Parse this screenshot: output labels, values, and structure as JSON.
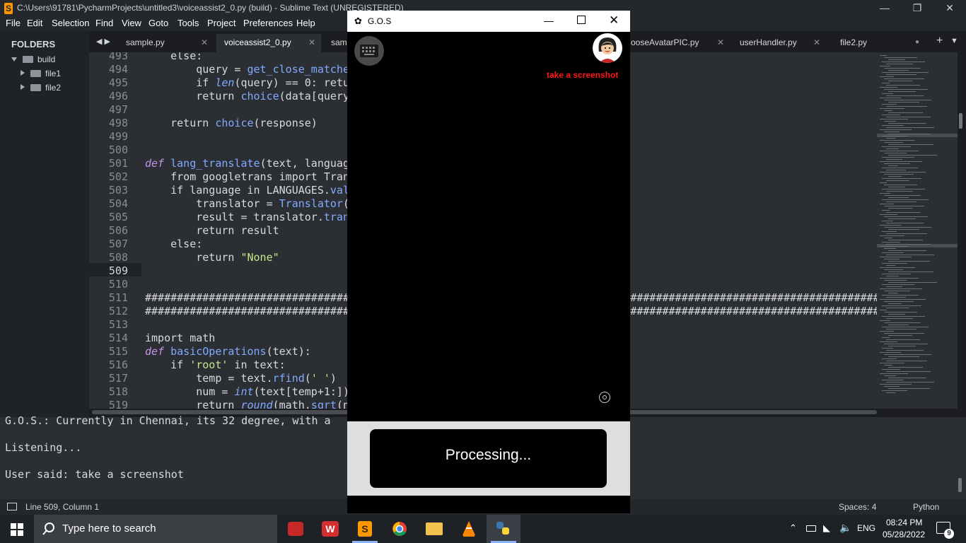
{
  "window": {
    "title": "C:\\Users\\91781\\PycharmProjects\\untitled3\\voiceassist2_0.py (build) - Sublime Text (UNREGISTERED)"
  },
  "menu": [
    "File",
    "Edit",
    "Selection",
    "Find",
    "View",
    "Goto",
    "Tools",
    "Project",
    "Preferences",
    "Help"
  ],
  "sidebar": {
    "header": "FOLDERS",
    "items": [
      {
        "label": "build"
      },
      {
        "label": "file1"
      },
      {
        "label": "file2"
      }
    ]
  },
  "tabs": [
    {
      "label": "sample.py"
    },
    {
      "label": "voiceassist2_0.py"
    },
    {
      "label": "samp"
    },
    {
      "label": "ooseAvatarPIC.py"
    },
    {
      "label": "userHandler.py"
    },
    {
      "label": "file2.py"
    }
  ],
  "editor": {
    "lines": [
      {
        "n": "493",
        "text": "    else:"
      },
      {
        "n": "494",
        "text": "        query = get_close_matches"
      },
      {
        "n": "495",
        "text": "        if len(query) == 0: retur"
      },
      {
        "n": "496",
        "text": "        return choice(data[query["
      },
      {
        "n": "497",
        "text": ""
      },
      {
        "n": "498",
        "text": "    return choice(response)"
      },
      {
        "n": "499",
        "text": ""
      },
      {
        "n": "500",
        "text": ""
      },
      {
        "n": "501",
        "text": "def lang_translate(text, language"
      },
      {
        "n": "502",
        "text": "    from googletrans import Trans"
      },
      {
        "n": "503",
        "text": "    if language in LANGUAGES.valu"
      },
      {
        "n": "504",
        "text": "        translator = Translator()"
      },
      {
        "n": "505",
        "text": "        result = translator.trans"
      },
      {
        "n": "506",
        "text": "        return result"
      },
      {
        "n": "507",
        "text": "    else:"
      },
      {
        "n": "508",
        "text": "        return \"None\""
      },
      {
        "n": "509",
        "text": ""
      },
      {
        "n": "510",
        "text": ""
      },
      {
        "n": "511",
        "text": "#############################################################################################################################"
      },
      {
        "n": "512",
        "text": "#############################################################################################################################"
      },
      {
        "n": "513",
        "text": ""
      },
      {
        "n": "514",
        "text": "import math"
      },
      {
        "n": "515",
        "text": "def basicOperations(text):"
      },
      {
        "n": "516",
        "text": "    if 'root' in text:"
      },
      {
        "n": "517",
        "text": "        temp = text.rfind(' ')"
      },
      {
        "n": "518",
        "text": "        num = int(text[temp+1:])"
      },
      {
        "n": "519",
        "text": "        return round(math.sqrt(nu"
      }
    ],
    "current_line": "509"
  },
  "console": {
    "lines": [
      "G.O.S.: Currently in Chennai, its 32 degree, with a",
      "Listening...",
      "User said: take a screenshot"
    ]
  },
  "status": {
    "position": "Line 509, Column 1",
    "spaces": "Spaces: 4",
    "syntax": "Python"
  },
  "taskbar": {
    "search_placeholder": "Type here to search",
    "language": "ENG",
    "time": "08:24 PM",
    "date": "05/28/2022",
    "notifications": "9"
  },
  "gos": {
    "title": "G.O.S",
    "command_label": "take a screenshot",
    "status_text": "Processing...",
    "accent": "#ff1a1a"
  },
  "icons": [
    "sublime-logo-icon",
    "keyboard-icon",
    "avatar-icon",
    "settings-icon",
    "search-icon",
    "windows-start-icon",
    "folder-icon"
  ]
}
